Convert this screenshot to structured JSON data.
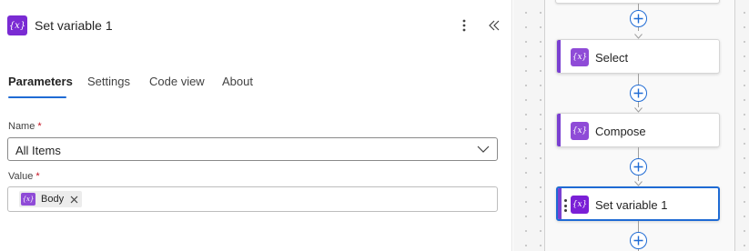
{
  "panel": {
    "icon_glyph": "{x}",
    "title": "Set variable 1",
    "more_icon": "more-vertical-icon",
    "collapse_icon": "double-chevron-left-icon"
  },
  "tabs": [
    {
      "label": "Parameters",
      "active": true
    },
    {
      "label": "Settings",
      "active": false
    },
    {
      "label": "Code view",
      "active": false
    },
    {
      "label": "About",
      "active": false
    }
  ],
  "form": {
    "name": {
      "label": "Name",
      "required_mark": "*",
      "value": "All Items"
    },
    "value": {
      "label": "Value",
      "required_mark": "*",
      "token": {
        "icon_glyph": "{x}",
        "label": "Body"
      }
    }
  },
  "canvas": {
    "cards": [
      {
        "label": "Select",
        "icon_glyph": "{x}",
        "selected": false
      },
      {
        "label": "Compose",
        "icon_glyph": "{x}",
        "selected": false
      },
      {
        "label": "Set variable 1",
        "icon_glyph": "{x}",
        "selected": true
      }
    ]
  },
  "colors": {
    "accent_blue": "#1f6bd4",
    "variable_purple": "#7a2bd3",
    "required_red": "#c50f1f"
  }
}
